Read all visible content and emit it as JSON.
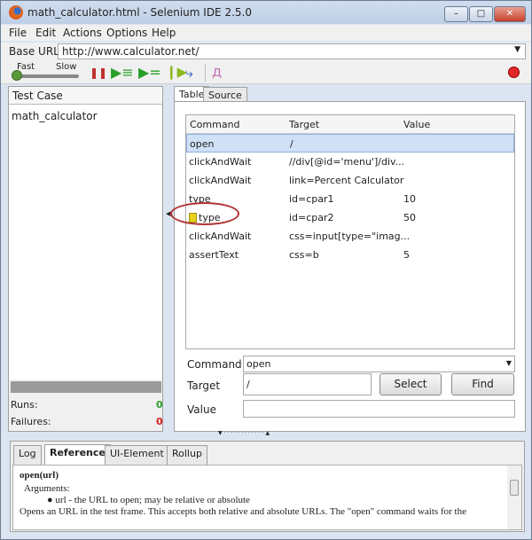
{
  "window": {
    "title": "math_calculator.html - Selenium IDE 2.5.0"
  },
  "menu": [
    "File",
    "Edit",
    "Actions",
    "Options",
    "Help"
  ],
  "base_url": {
    "label": "Base URL",
    "value": "http://www.calculator.net/"
  },
  "speed": {
    "fast": "Fast",
    "slow": "Slow",
    "level": 0
  },
  "test_case": {
    "header": "Test Case",
    "items": [
      "math_calculator"
    ],
    "runs_label": "Runs:",
    "runs": "0",
    "failures_label": "Failures:",
    "failures": "0"
  },
  "editor_tabs": [
    "Table",
    "Source"
  ],
  "table": {
    "headers": [
      "Command",
      "Target",
      "Value"
    ],
    "rows": [
      {
        "command": "open",
        "target": "/",
        "value": ""
      },
      {
        "command": "clickAndWait",
        "target": "//div[@id='menu']/div...",
        "value": ""
      },
      {
        "command": "clickAndWait",
        "target": "link=Percent Calculator",
        "value": ""
      },
      {
        "command": "type",
        "target": "id=cpar1",
        "value": "10"
      },
      {
        "command": "type",
        "target": "id=cpar2",
        "value": "50"
      },
      {
        "command": "clickAndWait",
        "target": "css=input[type=\"imag...",
        "value": ""
      },
      {
        "command": "assertText",
        "target": "css=b",
        "value": "5"
      }
    ]
  },
  "form": {
    "command_label": "Command",
    "command_value": "open",
    "target_label": "Target",
    "target_value": "/",
    "value_label": "Value",
    "value_value": "",
    "select_btn": "Select",
    "find_btn": "Find"
  },
  "bottom_tabs": [
    "Log",
    "Reference",
    "UI-Element",
    "Rollup"
  ],
  "reference": {
    "signature": "open(url)",
    "args_label": "Arguments:",
    "arg": "url - the URL to open; may be relative or absolute",
    "desc": "Opens an URL in the test frame. This accepts both relative and absolute URLs. The \"open\" command waits for the"
  },
  "colors": {
    "selected_row": "#cfe0f7",
    "runs": "#2a9d2a",
    "failures": "#d42020",
    "annotation": "#b03030"
  }
}
